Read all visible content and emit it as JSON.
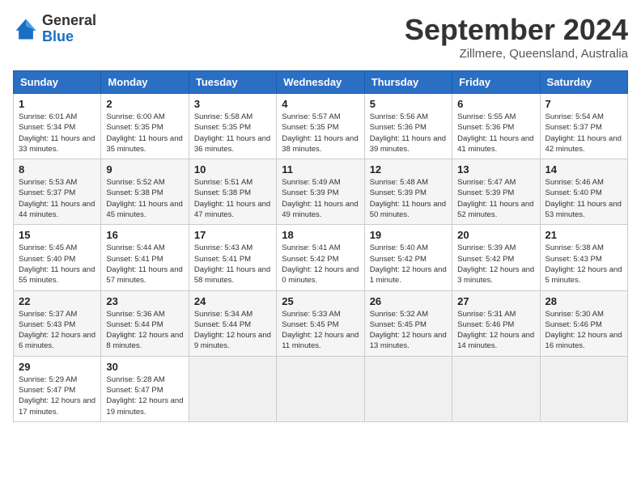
{
  "header": {
    "logo": {
      "general": "General",
      "blue": "Blue"
    },
    "title": "September 2024",
    "subtitle": "Zillmere, Queensland, Australia"
  },
  "calendar": {
    "days_of_week": [
      "Sunday",
      "Monday",
      "Tuesday",
      "Wednesday",
      "Thursday",
      "Friday",
      "Saturday"
    ],
    "weeks": [
      [
        null,
        {
          "day": 2,
          "sunrise": "6:00 AM",
          "sunset": "5:35 PM",
          "daylight": "11 hours and 35 minutes."
        },
        {
          "day": 3,
          "sunrise": "5:58 AM",
          "sunset": "5:35 PM",
          "daylight": "11 hours and 36 minutes."
        },
        {
          "day": 4,
          "sunrise": "5:57 AM",
          "sunset": "5:35 PM",
          "daylight": "11 hours and 38 minutes."
        },
        {
          "day": 5,
          "sunrise": "5:56 AM",
          "sunset": "5:36 PM",
          "daylight": "11 hours and 39 minutes."
        },
        {
          "day": 6,
          "sunrise": "5:55 AM",
          "sunset": "5:36 PM",
          "daylight": "11 hours and 41 minutes."
        },
        {
          "day": 7,
          "sunrise": "5:54 AM",
          "sunset": "5:37 PM",
          "daylight": "11 hours and 42 minutes."
        }
      ],
      [
        {
          "day": 1,
          "sunrise": "6:01 AM",
          "sunset": "5:34 PM",
          "daylight": "11 hours and 33 minutes."
        },
        {
          "day": 8,
          "sunrise": "5:53 AM",
          "sunset": "5:37 PM",
          "daylight": "11 hours and 44 minutes."
        },
        {
          "day": 9,
          "sunrise": "5:52 AM",
          "sunset": "5:38 PM",
          "daylight": "11 hours and 45 minutes."
        },
        {
          "day": 10,
          "sunrise": "5:51 AM",
          "sunset": "5:38 PM",
          "daylight": "11 hours and 47 minutes."
        },
        {
          "day": 11,
          "sunrise": "5:49 AM",
          "sunset": "5:39 PM",
          "daylight": "11 hours and 49 minutes."
        },
        {
          "day": 12,
          "sunrise": "5:48 AM",
          "sunset": "5:39 PM",
          "daylight": "11 hours and 50 minutes."
        },
        {
          "day": 13,
          "sunrise": "5:47 AM",
          "sunset": "5:39 PM",
          "daylight": "11 hours and 52 minutes."
        },
        {
          "day": 14,
          "sunrise": "5:46 AM",
          "sunset": "5:40 PM",
          "daylight": "11 hours and 53 minutes."
        }
      ],
      [
        {
          "day": 15,
          "sunrise": "5:45 AM",
          "sunset": "5:40 PM",
          "daylight": "11 hours and 55 minutes."
        },
        {
          "day": 16,
          "sunrise": "5:44 AM",
          "sunset": "5:41 PM",
          "daylight": "11 hours and 57 minutes."
        },
        {
          "day": 17,
          "sunrise": "5:43 AM",
          "sunset": "5:41 PM",
          "daylight": "11 hours and 58 minutes."
        },
        {
          "day": 18,
          "sunrise": "5:41 AM",
          "sunset": "5:42 PM",
          "daylight": "12 hours and 0 minutes."
        },
        {
          "day": 19,
          "sunrise": "5:40 AM",
          "sunset": "5:42 PM",
          "daylight": "12 hours and 1 minute."
        },
        {
          "day": 20,
          "sunrise": "5:39 AM",
          "sunset": "5:42 PM",
          "daylight": "12 hours and 3 minutes."
        },
        {
          "day": 21,
          "sunrise": "5:38 AM",
          "sunset": "5:43 PM",
          "daylight": "12 hours and 5 minutes."
        }
      ],
      [
        {
          "day": 22,
          "sunrise": "5:37 AM",
          "sunset": "5:43 PM",
          "daylight": "12 hours and 6 minutes."
        },
        {
          "day": 23,
          "sunrise": "5:36 AM",
          "sunset": "5:44 PM",
          "daylight": "12 hours and 8 minutes."
        },
        {
          "day": 24,
          "sunrise": "5:34 AM",
          "sunset": "5:44 PM",
          "daylight": "12 hours and 9 minutes."
        },
        {
          "day": 25,
          "sunrise": "5:33 AM",
          "sunset": "5:45 PM",
          "daylight": "12 hours and 11 minutes."
        },
        {
          "day": 26,
          "sunrise": "5:32 AM",
          "sunset": "5:45 PM",
          "daylight": "12 hours and 13 minutes."
        },
        {
          "day": 27,
          "sunrise": "5:31 AM",
          "sunset": "5:46 PM",
          "daylight": "12 hours and 14 minutes."
        },
        {
          "day": 28,
          "sunrise": "5:30 AM",
          "sunset": "5:46 PM",
          "daylight": "12 hours and 16 minutes."
        }
      ],
      [
        {
          "day": 29,
          "sunrise": "5:29 AM",
          "sunset": "5:47 PM",
          "daylight": "12 hours and 17 minutes."
        },
        {
          "day": 30,
          "sunrise": "5:28 AM",
          "sunset": "5:47 PM",
          "daylight": "12 hours and 19 minutes."
        },
        null,
        null,
        null,
        null,
        null
      ]
    ]
  }
}
